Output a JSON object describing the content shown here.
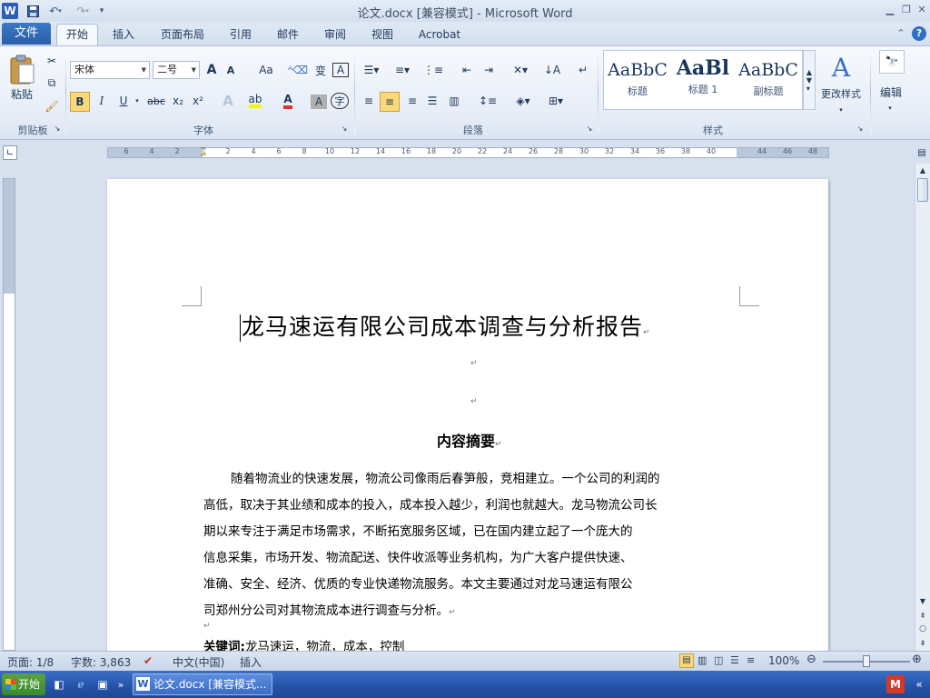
{
  "window": {
    "title": "论文.docx [兼容模式] - Microsoft Word",
    "app_icon": "W"
  },
  "quick_access": {
    "icons": [
      "save-icon",
      "undo-icon",
      "redo-icon",
      "customize-icon"
    ]
  },
  "tabs": {
    "file": "文件",
    "items": [
      "开始",
      "插入",
      "页面布局",
      "引用",
      "邮件",
      "审阅",
      "视图",
      "Acrobat"
    ],
    "active": "开始"
  },
  "ribbon": {
    "clipboard": {
      "paste": "粘贴",
      "label": "剪贴板"
    },
    "font": {
      "name": "宋体",
      "size": "二号",
      "label": "字体",
      "bold": "B",
      "italic": "I",
      "underline": "U",
      "strike": "abc",
      "sub": "x₂",
      "sup": "x²",
      "grow": "A",
      "shrink": "A",
      "case": "Aa",
      "text_color": "#e03030",
      "highlight_color": "#f5f500"
    },
    "paragraph": {
      "label": "段落"
    },
    "styles": {
      "label": "样式",
      "items": [
        {
          "preview": "AaBbC",
          "name": "标题"
        },
        {
          "preview": "AaBl",
          "name": "标题 1"
        },
        {
          "preview": "AaBbC",
          "name": "副标题"
        }
      ],
      "change": "更改样式"
    },
    "editing": {
      "label": "编辑"
    }
  },
  "ruler": {
    "numbers": [
      "6",
      "4",
      "2",
      "2",
      "4",
      "6",
      "8",
      "10",
      "12",
      "14",
      "16",
      "18",
      "20",
      "22",
      "24",
      "26",
      "28",
      "30",
      "32",
      "34",
      "36",
      "38",
      "40",
      "44",
      "46",
      "48"
    ]
  },
  "document": {
    "title": "龙马速运有限公司成本调查与分析报告",
    "abstract_heading": "内容摘要",
    "abstract_lines": [
      "随着物流业的快速发展，物流公司像雨后春笋般，竞相建立。一个公司的利润的",
      "高低，取决于其业绩和成本的投入，成本投入越少，利润也就越大。龙马物流公司长",
      "期以来专注于满足市场需求，不断拓宽服务区域，已在国内建立起了一个庞大的",
      "信息采集，市场开发、物流配送、快件收派等业务机构，为广大客户提供快速、",
      "准确、安全、经济、优质的专业快递物流服务。本文主要通过对龙马速运有限公",
      "司郑州分公司对其物流成本进行调查与分析。"
    ],
    "keywords_label": "关键词:",
    "keywords": "龙马速运，物流，成本，控制",
    "para_mark": "↵"
  },
  "status": {
    "page": "页面: 1/8",
    "words": "字数: 3,863",
    "language": "中文(中国)",
    "mode": "插入",
    "zoom": "100%"
  },
  "taskbar": {
    "start": "开始",
    "task": "论文.docx [兼容模式..."
  }
}
